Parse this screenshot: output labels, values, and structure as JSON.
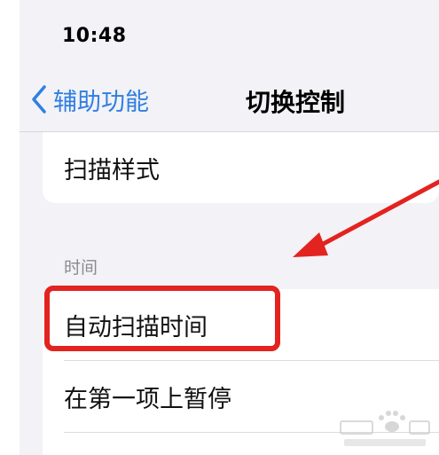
{
  "status_bar": {
    "time": "10:48"
  },
  "nav": {
    "back_label": "辅助功能",
    "title": "切换控制"
  },
  "settings": {
    "top_group": [
      {
        "label": "扫描样式"
      }
    ],
    "section_header": "时间",
    "timing_group": [
      {
        "label": "自动扫描时间",
        "highlighted": true
      },
      {
        "label": "在第一项上暂停",
        "highlighted": false
      }
    ]
  },
  "annotation": {
    "color": "#e3231f"
  },
  "icons": {
    "back": "chevron-left-icon",
    "watermark": "baidu-jingyan-watermark"
  }
}
